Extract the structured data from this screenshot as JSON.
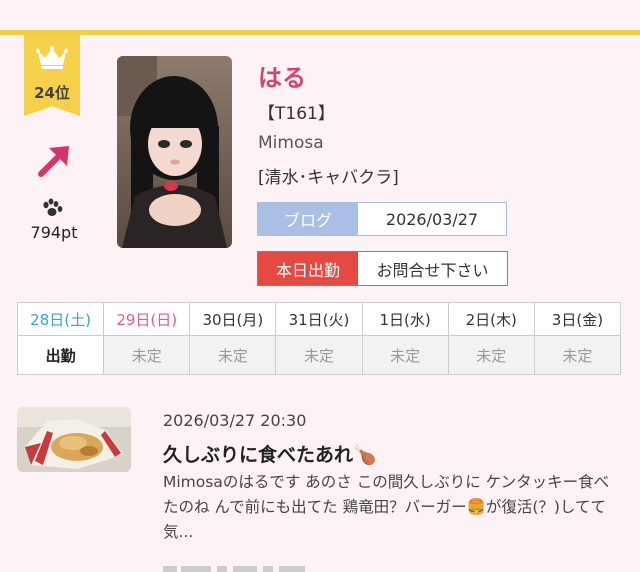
{
  "ranking": {
    "rank_label": "24位",
    "points": "794pt",
    "trend": "up"
  },
  "cast": {
    "name": "はる",
    "height": "【T161】",
    "shop": "Mimosa",
    "area_genre": "[清水･キャバクラ]"
  },
  "blog": {
    "label": "ブログ",
    "date": "2026/03/27"
  },
  "work": {
    "label": "本日出勤",
    "value": "お問合せ下さい"
  },
  "schedule": [
    {
      "day": "28日(土)",
      "status": "出勤"
    },
    {
      "day": "29日(日)",
      "status": "未定"
    },
    {
      "day": "30日(月)",
      "status": "未定"
    },
    {
      "day": "31日(火)",
      "status": "未定"
    },
    {
      "day": "1日(水)",
      "status": "未定"
    },
    {
      "day": "2日(木)",
      "status": "未定"
    },
    {
      "day": "3日(金)",
      "status": "未定"
    }
  ],
  "post": {
    "datetime": "2026/03/27 20:30",
    "title": "久しぶりに食べたあれ🍗",
    "excerpt": "Mimosaのはるです あのさ この間久しぶりに ケンタッキー食べたのね んで前にも出てた 鶏竜田？バーガー🍔が復活(？)してて 気..."
  },
  "colors": {
    "accent_gold": "#f2cf3e",
    "name_pink": "#d9416d",
    "blog_blue": "#aabfe4",
    "work_red": "#e44a42",
    "saturday": "#39a3c8",
    "sunday": "#de5c92",
    "background": "#fdf3f6"
  },
  "icons": {
    "rank": "crown-icon",
    "trend": "arrow-up-right-icon",
    "points": "paw-icon"
  }
}
